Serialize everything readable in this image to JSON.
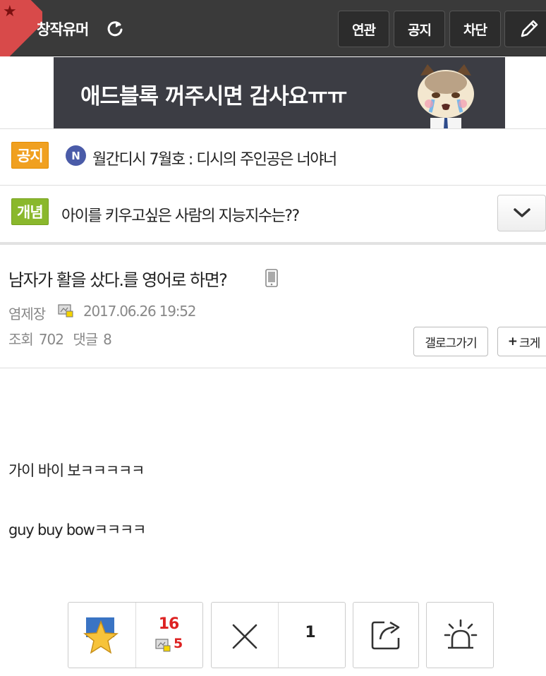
{
  "header": {
    "gallery_name": "창작유머",
    "buttons": {
      "related": "연관",
      "notice": "공지",
      "block": "차단"
    },
    "icons": [
      "star-icon",
      "refresh-icon",
      "pencil-icon"
    ]
  },
  "ad": {
    "text": "애드블록 꺼주시면 감사요ㅠㅠ"
  },
  "notice": {
    "badge": "공지",
    "icon_letter": "N",
    "text": "월간디시 7월호 : 디시의 주인공은 너야너"
  },
  "concept": {
    "badge": "개념",
    "text": "아이를 키우고싶은 사람의 지능지수는??"
  },
  "post": {
    "title": "남자가 활을 샀다.를 영어로 하면?",
    "author": "염제장",
    "date": "2017.06.26 19:52",
    "views_label": "조회",
    "views": "702",
    "comments_label": "댓글",
    "comments": "8",
    "gallery_button": "갤로그가기",
    "bigger_button": "크게",
    "content": [
      "가이 바이 보ㅋㅋㅋㅋㅋ",
      "guy buy bowㅋㅋㅋㅋ"
    ]
  },
  "actions": {
    "recommend_count": "16",
    "fixed_recommend_count": "5",
    "nonrecommend_count": "1"
  },
  "colors": {
    "header_bg": "#3a3a3a",
    "notice_badge": "#f0a020",
    "concept_badge": "#8ab82c",
    "count_red": "#d22222"
  }
}
